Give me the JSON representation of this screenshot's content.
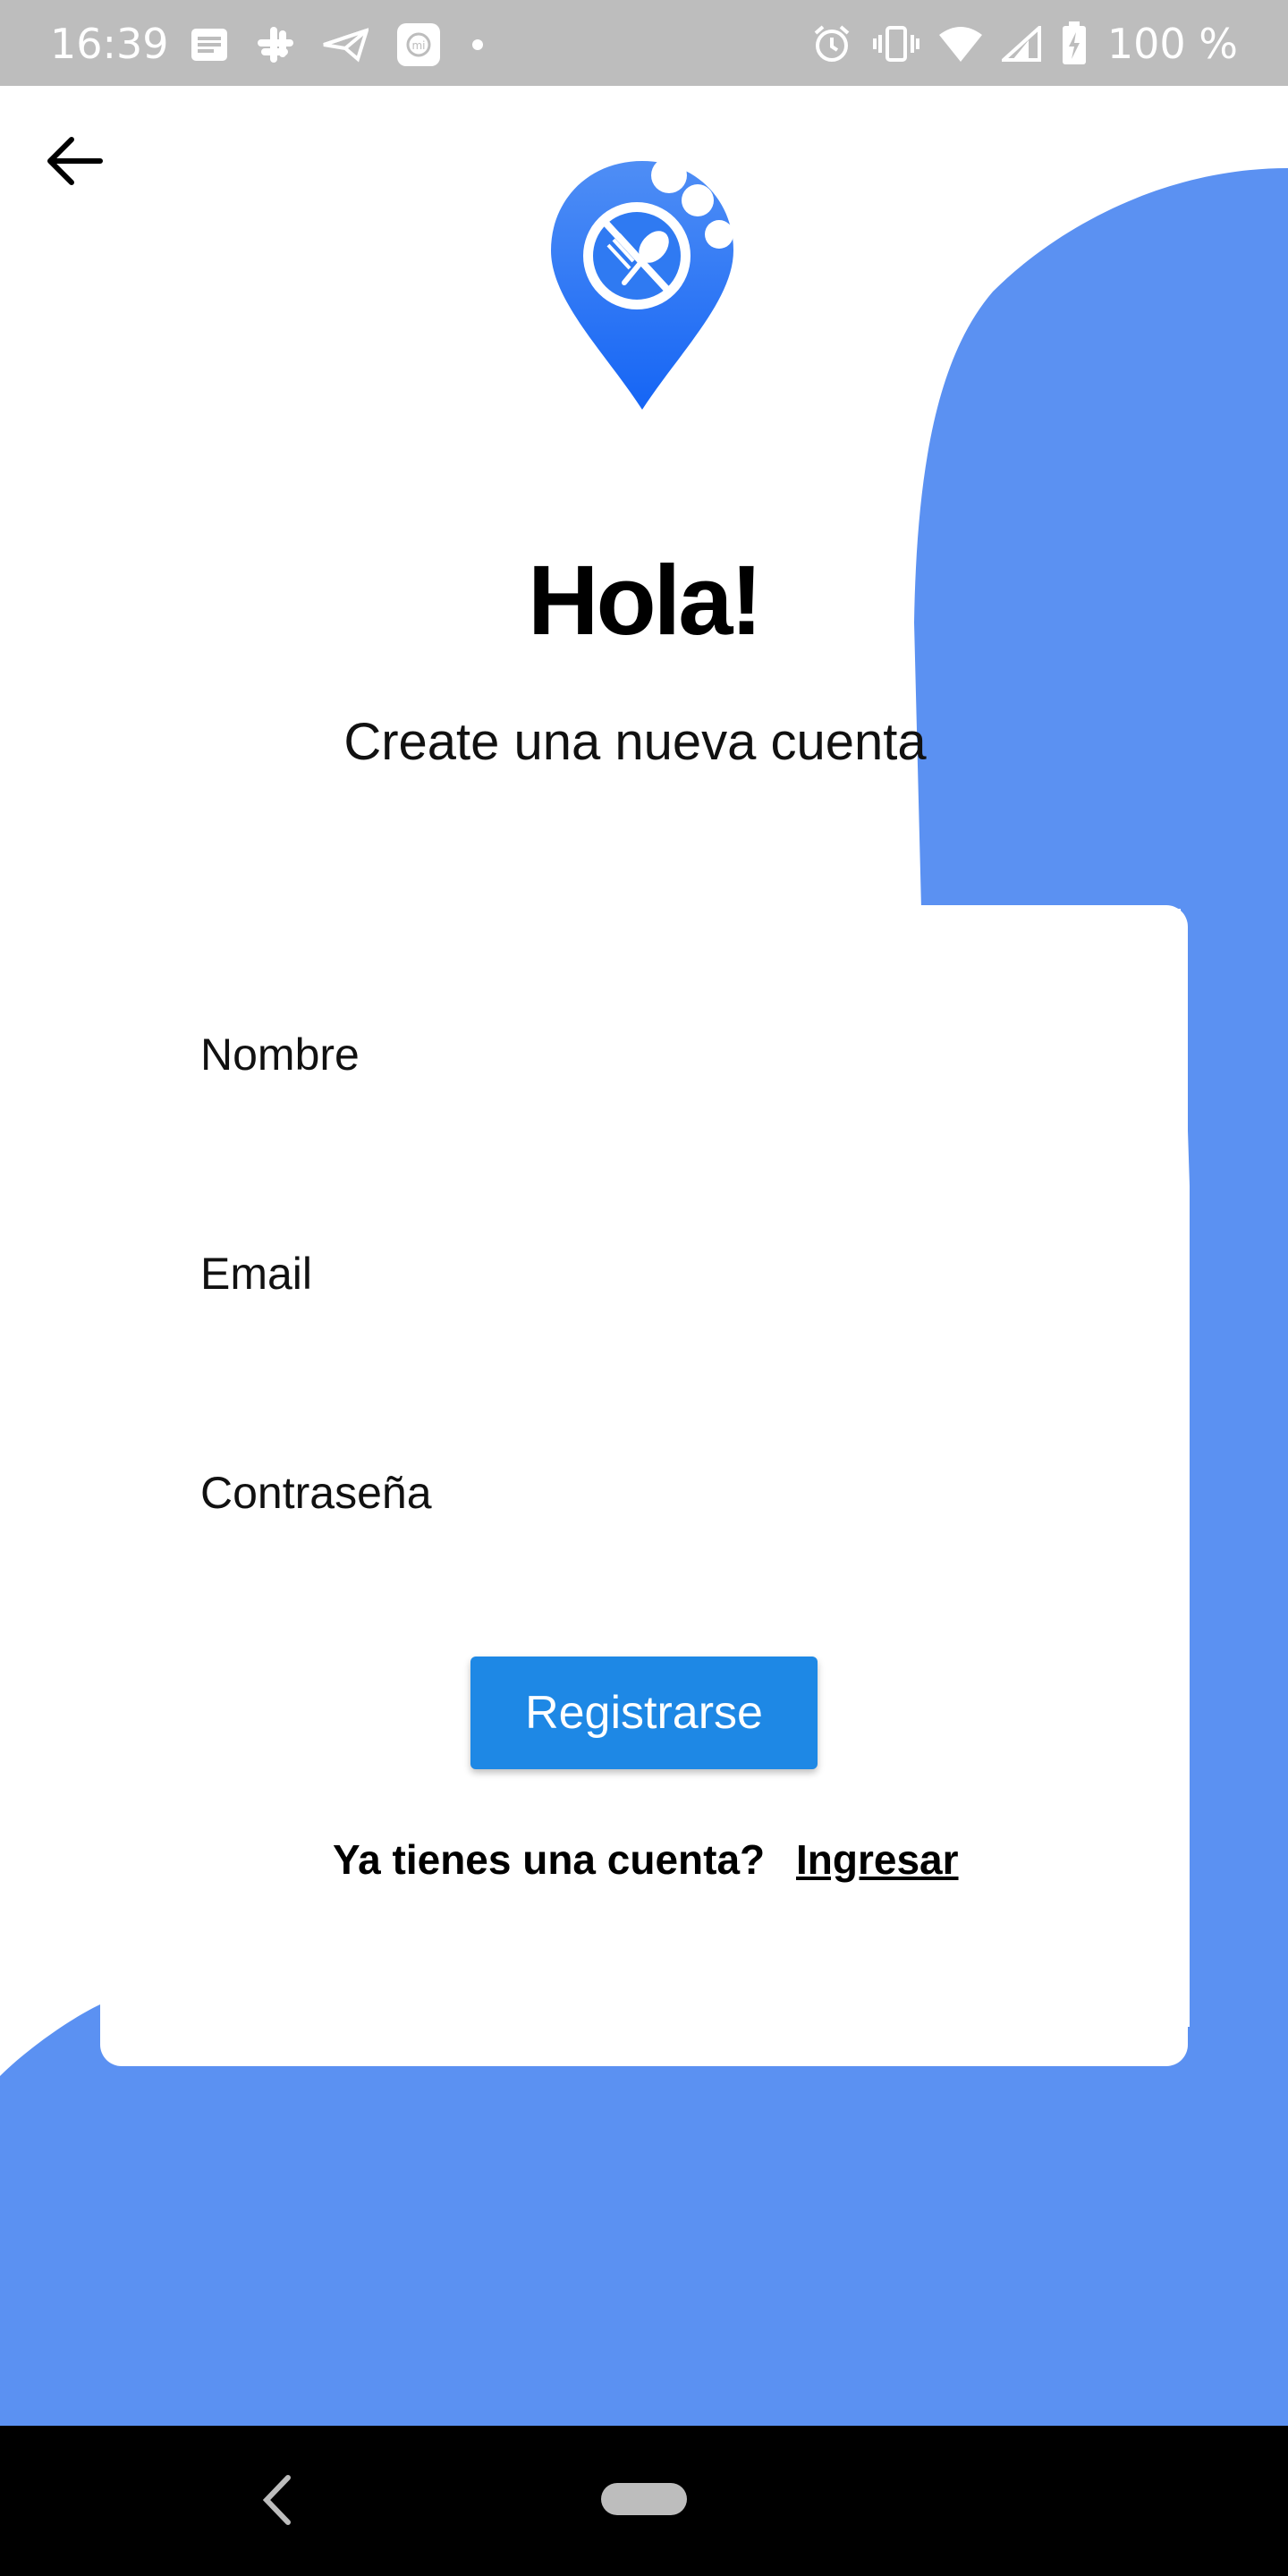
{
  "status_bar": {
    "time": "16:39",
    "battery": "100 %",
    "left_icons": [
      "notification-icon",
      "slack-icon",
      "send-icon",
      "mi-icon",
      "dot-icon"
    ],
    "right_icons": [
      "alarm-icon",
      "vibrate-icon",
      "wifi-icon",
      "signal-icon",
      "battery-charging-icon"
    ]
  },
  "header": {
    "back_icon": "arrow-back-icon",
    "logo_icon": "food-location-pin-icon"
  },
  "main": {
    "title": "Hola!",
    "subtitle": "Create una nueva cuenta"
  },
  "form": {
    "name_label": "Nombre",
    "email_label": "Email",
    "password_label": "Contraseña",
    "submit_label": "Registrarse",
    "have_account_text": "Ya tienes una cuenta?",
    "login_link": "Ingresar"
  },
  "nav": {
    "back_icon": "nav-back-icon",
    "home_icon": "home-pill-icon"
  },
  "colors": {
    "accent_blob": "#5b91f2",
    "button": "#1e88e5",
    "status_bar": "#bdbdbd",
    "logo_gradient_top": "#4f8ef5",
    "logo_gradient_bottom": "#1565f5"
  }
}
